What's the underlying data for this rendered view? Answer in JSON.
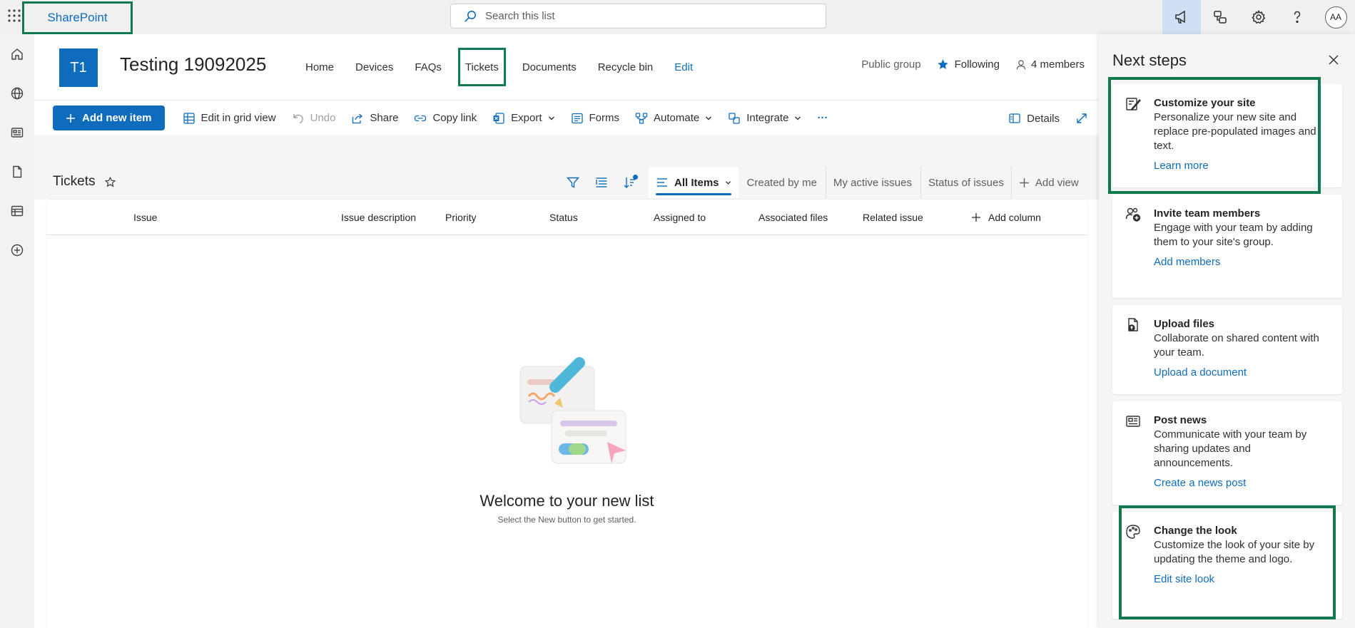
{
  "suitebar": {
    "app_name": "SharePoint",
    "search_placeholder": "Search this list",
    "avatar_initials": "AA"
  },
  "site": {
    "logo_initials": "T1",
    "title": "Testing 19092025",
    "nav": [
      {
        "label": "Home"
      },
      {
        "label": "Devices"
      },
      {
        "label": "FAQs"
      },
      {
        "label": "Tickets"
      },
      {
        "label": "Documents"
      },
      {
        "label": "Recycle bin"
      },
      {
        "label": "Edit"
      }
    ],
    "privacy": "Public group",
    "following": "Following",
    "members": "4 members"
  },
  "commands": {
    "add_new_item": "Add new item",
    "edit_grid": "Edit in grid view",
    "undo": "Undo",
    "share": "Share",
    "copy_link": "Copy link",
    "export": "Export",
    "forms": "Forms",
    "automate": "Automate",
    "integrate": "Integrate",
    "more": "···",
    "details": "Details"
  },
  "list": {
    "title": "Tickets",
    "views": {
      "active": "All Items",
      "tabs": [
        "Created by me",
        "My active issues",
        "Status of issues"
      ],
      "add_view": "Add view"
    },
    "columns": [
      "Issue",
      "Issue description",
      "Priority",
      "Status",
      "Assigned to",
      "Associated files",
      "Related issue"
    ],
    "add_column": "Add column",
    "empty_title": "Welcome to your new list",
    "empty_sub": "Select the New button to get started."
  },
  "next_steps": {
    "title": "Next steps",
    "cards": [
      {
        "icon": "customize-icon",
        "title": "Customize your site",
        "desc": "Personalize your new site and replace pre-populated images and text.",
        "link": "Learn more"
      },
      {
        "icon": "invite-members-icon",
        "title": "Invite team members",
        "desc": "Engage with your team by adding them to your site's group.",
        "link": "Add members"
      },
      {
        "icon": "upload-file-icon",
        "title": "Upload files",
        "desc": "Collaborate on shared content with your team.",
        "link": "Upload a document"
      },
      {
        "icon": "news-icon",
        "title": "Post news",
        "desc": "Communicate with your team by sharing updates and announcements.",
        "link": "Create a news post"
      },
      {
        "icon": "palette-icon",
        "title": "Change the look",
        "desc": "Customize the look of your site by updating the theme and logo.",
        "link": "Edit site look"
      }
    ]
  },
  "colors": {
    "accent": "#0f6cbd",
    "highlight_box": "#0e7a4e",
    "suitebar_bg": "#f0f0f0",
    "active_suite_btn": "#cfe0f4"
  }
}
